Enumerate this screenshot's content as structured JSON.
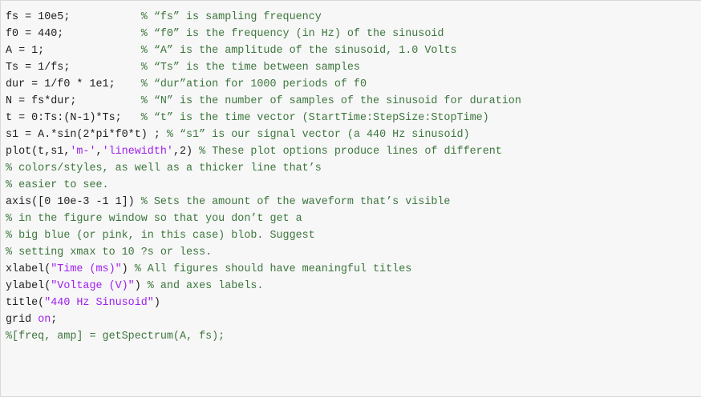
{
  "code": {
    "lines": [
      {
        "parts": [
          {
            "t": "fs = 10e5;           ",
            "k": "p"
          },
          {
            "t": "% “fs” is sampling frequency",
            "k": "c"
          }
        ]
      },
      {
        "parts": [
          {
            "t": "f0 = 440;            ",
            "k": "p"
          },
          {
            "t": "% “f0” is the frequency (in Hz) of the sinusoid",
            "k": "c"
          }
        ]
      },
      {
        "parts": [
          {
            "t": "A = 1;               ",
            "k": "p"
          },
          {
            "t": "% “A” is the amplitude of the sinusoid, 1.0 Volts",
            "k": "c"
          }
        ]
      },
      {
        "parts": [
          {
            "t": "Ts = 1/fs;           ",
            "k": "p"
          },
          {
            "t": "% “Ts” is the time between samples",
            "k": "c"
          }
        ]
      },
      {
        "parts": [
          {
            "t": "dur = 1/f0 * 1e1;    ",
            "k": "p"
          },
          {
            "t": "% “dur”ation for 1000 periods of f0",
            "k": "c"
          }
        ]
      },
      {
        "parts": [
          {
            "t": "N = fs*dur;          ",
            "k": "p"
          },
          {
            "t": "% “N” is the number of samples of the sinusoid for duration",
            "k": "c"
          }
        ]
      },
      {
        "parts": [
          {
            "t": "t = 0:Ts:(N-1)*Ts;   ",
            "k": "p"
          },
          {
            "t": "% “t” is the time vector (StartTime:StepSize:StopTime)",
            "k": "c"
          }
        ]
      },
      {
        "parts": [
          {
            "t": "s1 = A.*sin(2*pi*f0*t) ; ",
            "k": "p"
          },
          {
            "t": "% “s1” is our signal vector (a 440 Hz sinusoid)",
            "k": "c"
          }
        ]
      },
      {
        "parts": [
          {
            "t": "plot(t,s1,",
            "k": "p"
          },
          {
            "t": "'m-'",
            "k": "s"
          },
          {
            "t": ",",
            "k": "p"
          },
          {
            "t": "'linewidth'",
            "k": "s"
          },
          {
            "t": ",2) ",
            "k": "p"
          },
          {
            "t": "% These plot options produce lines of different",
            "k": "c"
          }
        ]
      },
      {
        "parts": [
          {
            "t": "% colors/styles, as well as a thicker line that’s",
            "k": "c"
          }
        ]
      },
      {
        "parts": [
          {
            "t": "% easier to see.",
            "k": "c"
          }
        ]
      },
      {
        "parts": [
          {
            "t": "axis([0 10e-3 -1 1]) ",
            "k": "p"
          },
          {
            "t": "% Sets the amount of the waveform that’s visible",
            "k": "c"
          }
        ]
      },
      {
        "parts": [
          {
            "t": "% in the figure window so that you don’t get a",
            "k": "c"
          }
        ]
      },
      {
        "parts": [
          {
            "t": "% big blue (or pink, in this case) blob. Suggest",
            "k": "c"
          }
        ]
      },
      {
        "parts": [
          {
            "t": "% setting xmax to 10 ?s or less.",
            "k": "c"
          }
        ]
      },
      {
        "parts": [
          {
            "t": "xlabel(",
            "k": "p"
          },
          {
            "t": "\"Time (ms)\"",
            "k": "s"
          },
          {
            "t": ") ",
            "k": "p"
          },
          {
            "t": "% All figures should have meaningful titles",
            "k": "c"
          }
        ]
      },
      {
        "parts": [
          {
            "t": "ylabel(",
            "k": "p"
          },
          {
            "t": "\"Voltage (V)\"",
            "k": "s"
          },
          {
            "t": ") ",
            "k": "p"
          },
          {
            "t": "% and axes labels.",
            "k": "c"
          }
        ]
      },
      {
        "parts": [
          {
            "t": "title(",
            "k": "p"
          },
          {
            "t": "\"440 Hz Sinusoid\"",
            "k": "s"
          },
          {
            "t": ")",
            "k": "p"
          }
        ]
      },
      {
        "parts": [
          {
            "t": "grid ",
            "k": "p"
          },
          {
            "t": "on",
            "k": "k"
          },
          {
            "t": ";",
            "k": "p"
          }
        ]
      },
      {
        "parts": [
          {
            "t": "%[freq, amp] = getSpectrum(A, fs);",
            "k": "c"
          }
        ]
      }
    ]
  },
  "colors": {
    "panel_background": "#f7f7f7",
    "panel_border": "#d9d9d9",
    "plain_text": "#1e1e1e",
    "comment": "#3c763d",
    "string": "#a020f0",
    "keyword": "#a020f0"
  }
}
